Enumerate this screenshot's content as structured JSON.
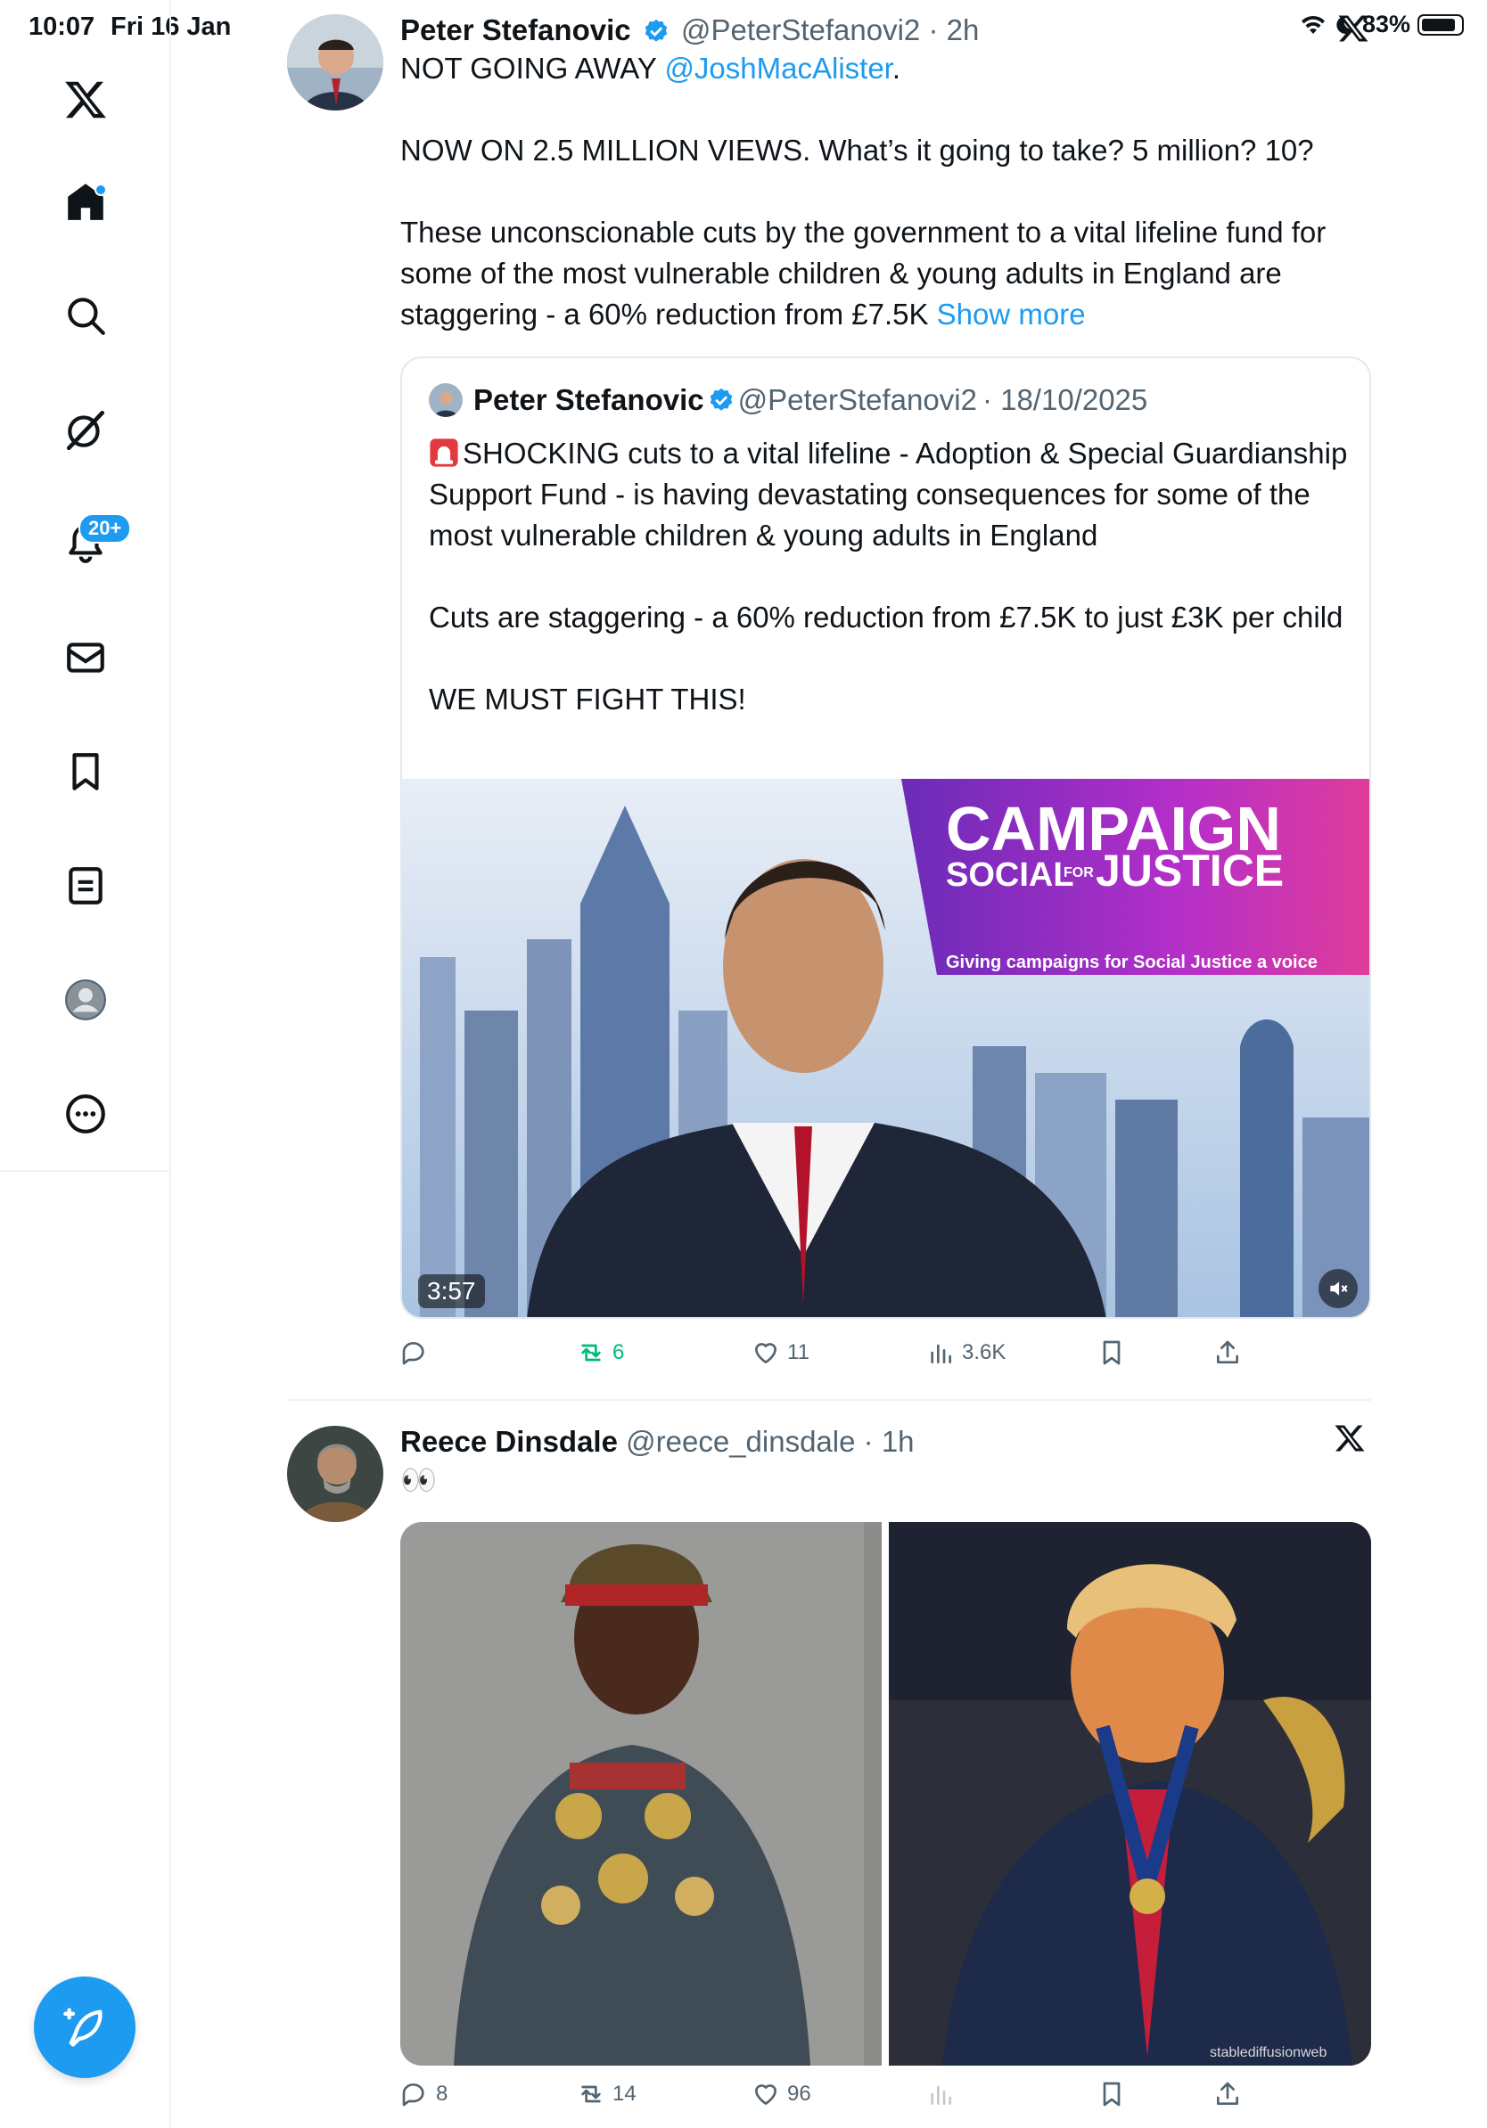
{
  "status_bar": {
    "time": "10:07",
    "date": "Fri 16 Jan",
    "battery": "83%"
  },
  "sidebar": {
    "items": [
      {
        "name": "x-logo"
      },
      {
        "name": "home"
      },
      {
        "name": "search"
      },
      {
        "name": "grok"
      },
      {
        "name": "notifications",
        "badge": "20+"
      },
      {
        "name": "messages"
      },
      {
        "name": "bookmarks"
      },
      {
        "name": "lists"
      },
      {
        "name": "profile"
      },
      {
        "name": "more"
      }
    ]
  },
  "tweets": [
    {
      "author": "Peter Stefanovic",
      "handle": "@PeterStefanovi2",
      "time": "· 2h",
      "text_before": "NOT GOING AWAY ",
      "mention": "@JoshMacAlister",
      "text_after": ".\n\nNOW ON 2.5 MILLION VIEWS. What’s it going to take? 5 million? 10?\n\nThese unconscionable cuts by the government to a vital lifeline fund for some of the most vulnerable children & young adults in England are staggering - a 60% reduction from £7.5K ",
      "show_more": "Show more",
      "quote": {
        "author": "Peter Stefanovic",
        "handle": "@PeterStefanovi2",
        "date": "· 18/10/2025",
        "text": "SHOCKING cuts to a vital lifeline - Adoption & Special Guardianship Support Fund - is having devastating consequences for some of the most vulnerable children & young adults in England\n\nCuts are staggering - a 60% reduction from £7.5K to just £3K per child\n\nWE MUST FIGHT THIS!",
        "video": {
          "duration": "3:57",
          "banner_title": "CAMPAIGN",
          "banner_sub_a": "SOCIAL",
          "banner_sub_for": "FOR",
          "banner_sub_b": "JUSTICE",
          "banner_tagline": "Giving campaigns for Social Justice a voice"
        }
      },
      "actions": {
        "reply": "",
        "retweets": "6",
        "likes": "11",
        "views": "3.6K"
      }
    },
    {
      "author": "Reece Dinsdale",
      "handle": "@reece_dinsdale",
      "time": "· 1h",
      "text": "👀",
      "images": [
        {
          "name": "military-uniform-photo"
        },
        {
          "name": "medal-suit-photo",
          "watermark": "stablediffusionweb"
        }
      ],
      "actions": {
        "reply": "8",
        "retweets": "14",
        "likes": "96",
        "views": ""
      }
    }
  ],
  "colors": {
    "accent": "#1d9bf0",
    "text": "#0f1419",
    "muted": "#536471",
    "retweet": "#00ba7c"
  }
}
